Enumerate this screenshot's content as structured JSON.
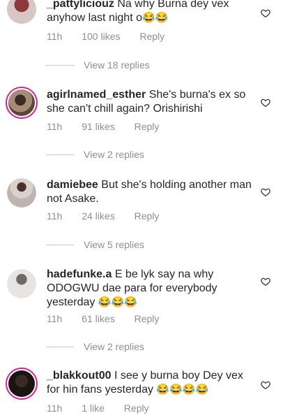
{
  "comments": [
    {
      "username": "_pattyliciouz",
      "text": "Na why Burna dey vex anyhow last night o",
      "emojis": "😂😂",
      "time": "11h",
      "likes": "100 likes",
      "reply": "Reply",
      "replies": "View 18 replies"
    },
    {
      "username": "agirlnamed_esther",
      "text": "She's burna's ex so she can't chill again? Orishirishi",
      "emojis": "",
      "time": "11h",
      "likes": "91 likes",
      "reply": "Reply",
      "replies": "View 2 replies"
    },
    {
      "username": "damiebee",
      "text": "But she's holding another man not Asake.",
      "emojis": "",
      "time": "11h",
      "likes": "24 likes",
      "reply": "Reply",
      "replies": "View 5 replies"
    },
    {
      "username": "hadefunke.a",
      "text": "E be lyk say na why ODOGWU dae para for everybody yesterday",
      "emojis": "😂😂😂",
      "time": "11h",
      "likes": "61 likes",
      "reply": "Reply",
      "replies": "View 2 replies"
    },
    {
      "username": "_blakkout00",
      "text": "I see y burna boy Dey vex for hin fans yesterday",
      "emojis": "😂😂😂😂",
      "time": "11h",
      "likes": "1 like",
      "reply": "Reply",
      "replies": ""
    }
  ],
  "icons": {
    "like": "heart-icon"
  },
  "colors": {
    "meta": "#8e8e8e",
    "text": "#262626",
    "story_ring": "#d6249f"
  }
}
